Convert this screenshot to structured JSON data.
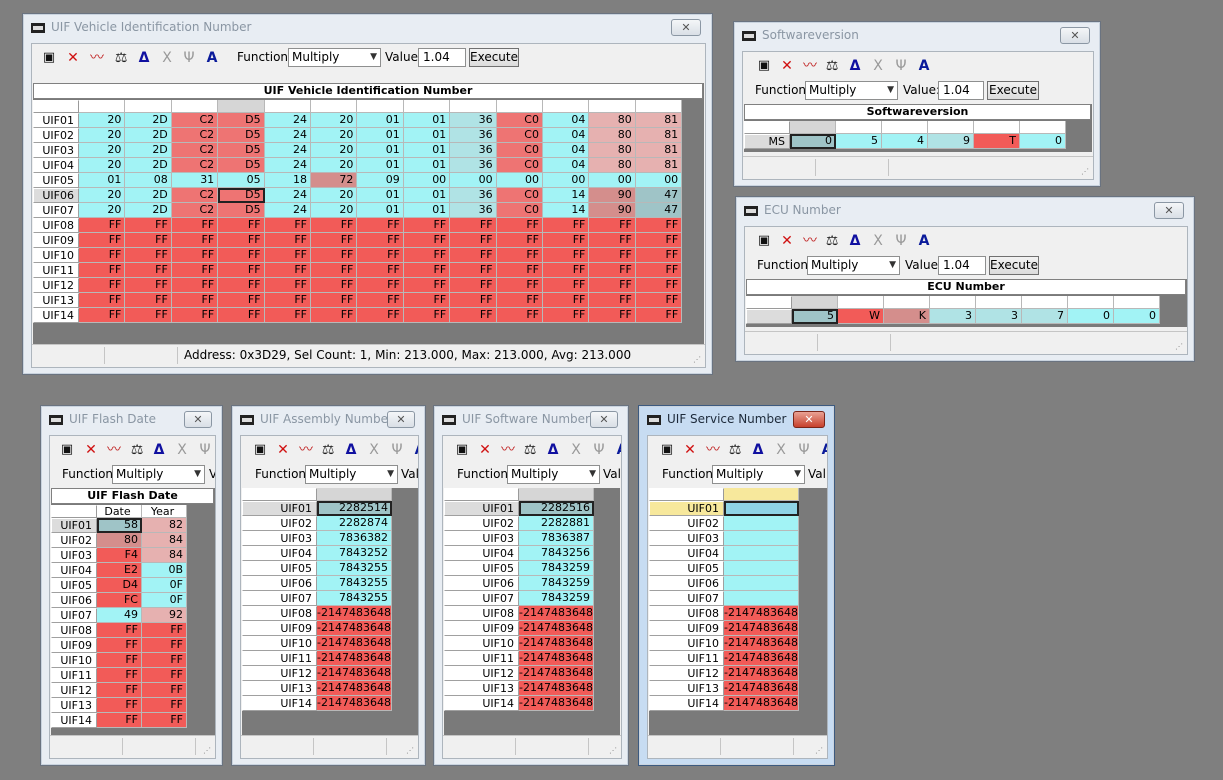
{
  "toolbar": {
    "function_label": "Function:",
    "function_value": "Multiply",
    "value_label": "Value:",
    "value": "1.04",
    "execute": "Execute",
    "value_label_cut": "Va",
    "value_label_cut2": "Valu"
  },
  "vin": {
    "title": "UIF Vehicle Identification Number",
    "grid_title": "UIF Vehicle Identification Number",
    "rows": [
      {
        "label": "UIF01",
        "cells": [
          "20",
          "2D",
          "C2",
          "D5",
          "24",
          "20",
          "01",
          "01",
          "36",
          "C0",
          "04",
          "80",
          "81"
        ]
      },
      {
        "label": "UIF02",
        "cells": [
          "20",
          "2D",
          "C2",
          "D5",
          "24",
          "20",
          "01",
          "01",
          "36",
          "C0",
          "04",
          "80",
          "81"
        ]
      },
      {
        "label": "UIF03",
        "cells": [
          "20",
          "2D",
          "C2",
          "D5",
          "24",
          "20",
          "01",
          "01",
          "36",
          "C0",
          "04",
          "80",
          "81"
        ]
      },
      {
        "label": "UIF04",
        "cells": [
          "20",
          "2D",
          "C2",
          "D5",
          "24",
          "20",
          "01",
          "01",
          "36",
          "C0",
          "04",
          "80",
          "81"
        ]
      },
      {
        "label": "UIF05",
        "cells": [
          "01",
          "08",
          "31",
          "05",
          "18",
          "72",
          "09",
          "00",
          "00",
          "00",
          "00",
          "00",
          "00"
        ]
      },
      {
        "label": "UIF06",
        "cells": [
          "20",
          "2D",
          "C2",
          "D5",
          "24",
          "20",
          "01",
          "01",
          "36",
          "C0",
          "14",
          "90",
          "47"
        ]
      },
      {
        "label": "UIF07",
        "cells": [
          "20",
          "2D",
          "C2",
          "D5",
          "24",
          "20",
          "01",
          "01",
          "36",
          "C0",
          "14",
          "90",
          "47"
        ]
      },
      {
        "label": "UIF08",
        "cells": [
          "FF",
          "FF",
          "FF",
          "FF",
          "FF",
          "FF",
          "FF",
          "FF",
          "FF",
          "FF",
          "FF",
          "FF",
          "FF"
        ]
      },
      {
        "label": "UIF09",
        "cells": [
          "FF",
          "FF",
          "FF",
          "FF",
          "FF",
          "FF",
          "FF",
          "FF",
          "FF",
          "FF",
          "FF",
          "FF",
          "FF"
        ]
      },
      {
        "label": "UIF10",
        "cells": [
          "FF",
          "FF",
          "FF",
          "FF",
          "FF",
          "FF",
          "FF",
          "FF",
          "FF",
          "FF",
          "FF",
          "FF",
          "FF"
        ]
      },
      {
        "label": "UIF11",
        "cells": [
          "FF",
          "FF",
          "FF",
          "FF",
          "FF",
          "FF",
          "FF",
          "FF",
          "FF",
          "FF",
          "FF",
          "FF",
          "FF"
        ]
      },
      {
        "label": "UIF12",
        "cells": [
          "FF",
          "FF",
          "FF",
          "FF",
          "FF",
          "FF",
          "FF",
          "FF",
          "FF",
          "FF",
          "FF",
          "FF",
          "FF"
        ]
      },
      {
        "label": "UIF13",
        "cells": [
          "FF",
          "FF",
          "FF",
          "FF",
          "FF",
          "FF",
          "FF",
          "FF",
          "FF",
          "FF",
          "FF",
          "FF",
          "FF"
        ]
      },
      {
        "label": "UIF14",
        "cells": [
          "FF",
          "FF",
          "FF",
          "FF",
          "FF",
          "FF",
          "FF",
          "FF",
          "FF",
          "FF",
          "FF",
          "FF",
          "FF"
        ]
      }
    ],
    "status": "Address: 0x3D29, Sel Count: 1, Min: 213.000, Max: 213.000, Avg: 213.000"
  },
  "swver": {
    "title": "Softwareversion",
    "grid_title": "Softwareversion",
    "row_label": "MS",
    "cells": [
      "0",
      "5",
      "4",
      "9",
      "T",
      "0"
    ]
  },
  "ecu": {
    "title": "ECU Number",
    "grid_title": "ECU Number",
    "cells": [
      "5",
      "W",
      "K",
      "3",
      "3",
      "7",
      "0",
      "0"
    ]
  },
  "flash": {
    "title": "UIF Flash Date",
    "grid_title": "UIF Flash Date",
    "col_date": "Date",
    "col_year": "Year",
    "rows": [
      {
        "label": "UIF01",
        "date": "58",
        "year": "82"
      },
      {
        "label": "UIF02",
        "date": "80",
        "year": "84"
      },
      {
        "label": "UIF03",
        "date": "F4",
        "year": "84"
      },
      {
        "label": "UIF04",
        "date": "E2",
        "year": "0B"
      },
      {
        "label": "UIF05",
        "date": "D4",
        "year": "0F"
      },
      {
        "label": "UIF06",
        "date": "FC",
        "year": "0F"
      },
      {
        "label": "UIF07",
        "date": "49",
        "year": "92"
      },
      {
        "label": "UIF08",
        "date": "FF",
        "year": "FF"
      },
      {
        "label": "UIF09",
        "date": "FF",
        "year": "FF"
      },
      {
        "label": "UIF10",
        "date": "FF",
        "year": "FF"
      },
      {
        "label": "UIF11",
        "date": "FF",
        "year": "FF"
      },
      {
        "label": "UIF12",
        "date": "FF",
        "year": "FF"
      },
      {
        "label": "UIF13",
        "date": "FF",
        "year": "FF"
      },
      {
        "label": "UIF14",
        "date": "FF",
        "year": "FF"
      }
    ]
  },
  "assembly": {
    "title": "UIF Assembly Number",
    "rows": [
      {
        "label": "UIF01",
        "value": "2282514"
      },
      {
        "label": "UIF02",
        "value": "2282874"
      },
      {
        "label": "UIF03",
        "value": "7836382"
      },
      {
        "label": "UIF04",
        "value": "7843252"
      },
      {
        "label": "UIF05",
        "value": "7843255"
      },
      {
        "label": "UIF06",
        "value": "7843255"
      },
      {
        "label": "UIF07",
        "value": "7843255"
      },
      {
        "label": "UIF08",
        "value": "-2147483648"
      },
      {
        "label": "UIF09",
        "value": "-2147483648"
      },
      {
        "label": "UIF10",
        "value": "-2147483648"
      },
      {
        "label": "UIF11",
        "value": "-2147483648"
      },
      {
        "label": "UIF12",
        "value": "-2147483648"
      },
      {
        "label": "UIF13",
        "value": "-2147483648"
      },
      {
        "label": "UIF14",
        "value": "-2147483648"
      }
    ]
  },
  "software": {
    "title": "UIF Software Number",
    "rows": [
      {
        "label": "UIF01",
        "value": "2282516"
      },
      {
        "label": "UIF02",
        "value": "2282881"
      },
      {
        "label": "UIF03",
        "value": "7836387"
      },
      {
        "label": "UIF04",
        "value": "7843256"
      },
      {
        "label": "UIF05",
        "value": "7843259"
      },
      {
        "label": "UIF06",
        "value": "7843259"
      },
      {
        "label": "UIF07",
        "value": "7843259"
      },
      {
        "label": "UIF08",
        "value": "-2147483648"
      },
      {
        "label": "UIF09",
        "value": "-2147483648"
      },
      {
        "label": "UIF10",
        "value": "-2147483648"
      },
      {
        "label": "UIF11",
        "value": "-2147483648"
      },
      {
        "label": "UIF12",
        "value": "-2147483648"
      },
      {
        "label": "UIF13",
        "value": "-2147483648"
      },
      {
        "label": "UIF14",
        "value": "-2147483648"
      }
    ]
  },
  "service": {
    "title": "UIF Service Number",
    "rows": [
      {
        "label": "UIF01",
        "value": ""
      },
      {
        "label": "UIF02",
        "value": ""
      },
      {
        "label": "UIF03",
        "value": ""
      },
      {
        "label": "UIF04",
        "value": ""
      },
      {
        "label": "UIF05",
        "value": ""
      },
      {
        "label": "UIF06",
        "value": ""
      },
      {
        "label": "UIF07",
        "value": ""
      },
      {
        "label": "UIF08",
        "value": "-2147483648"
      },
      {
        "label": "UIF09",
        "value": "-2147483648"
      },
      {
        "label": "UIF10",
        "value": "-2147483648"
      },
      {
        "label": "UIF11",
        "value": "-2147483648"
      },
      {
        "label": "UIF12",
        "value": "-2147483648"
      },
      {
        "label": "UIF13",
        "value": "-2147483648"
      },
      {
        "label": "UIF14",
        "value": "-2147483648"
      }
    ]
  },
  "colors": {
    "cyan": "#a2f3f5",
    "teal": "#b0e3e5",
    "red": "#f25b58",
    "rose": "#d48e8c",
    "pink": "#e6b1b0"
  },
  "icons": [
    "save-icon",
    "delete-icon",
    "chart-icon",
    "scale-icon",
    "delta-icon",
    "x-icon",
    "fork-icon",
    "font-icon",
    "close-icon",
    "window-icon"
  ]
}
